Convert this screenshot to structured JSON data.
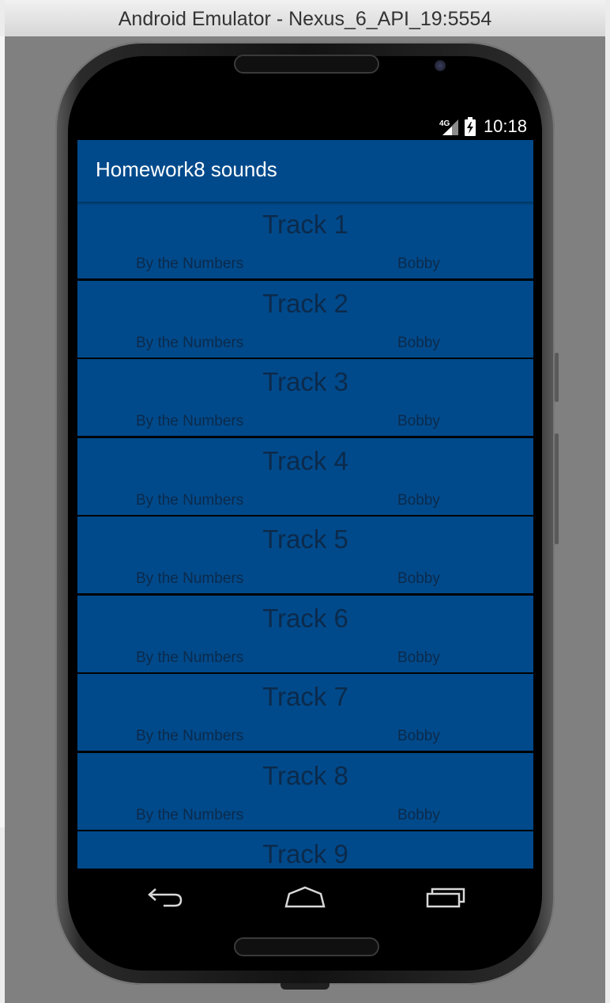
{
  "window": {
    "title": "Android Emulator - Nexus_6_API_19:5554"
  },
  "statusbar": {
    "network": "4G",
    "time": "10:18"
  },
  "app": {
    "title": "Homework8 sounds"
  },
  "tracks": [
    {
      "title": "Track 1",
      "album": "By the Numbers",
      "artist": "Bobby"
    },
    {
      "title": "Track 2",
      "album": "By the Numbers",
      "artist": "Bobby"
    },
    {
      "title": "Track 3",
      "album": "By the Numbers",
      "artist": "Bobby"
    },
    {
      "title": "Track 4",
      "album": "By the Numbers",
      "artist": "Bobby"
    },
    {
      "title": "Track 5",
      "album": "By the Numbers",
      "artist": "Bobby"
    },
    {
      "title": "Track 6",
      "album": "By the Numbers",
      "artist": "Bobby"
    },
    {
      "title": "Track 7",
      "album": "By the Numbers",
      "artist": "Bobby"
    },
    {
      "title": "Track 8",
      "album": "By the Numbers",
      "artist": "Bobby"
    },
    {
      "title": "Track 9"
    }
  ],
  "navbar": {
    "icons": [
      "back-icon",
      "home-icon",
      "recents-icon"
    ]
  },
  "colors": {
    "actionbar": "#004a8b",
    "row_background": "#004a8b",
    "row_text": "#0c2a4b",
    "divider": "#000000"
  }
}
